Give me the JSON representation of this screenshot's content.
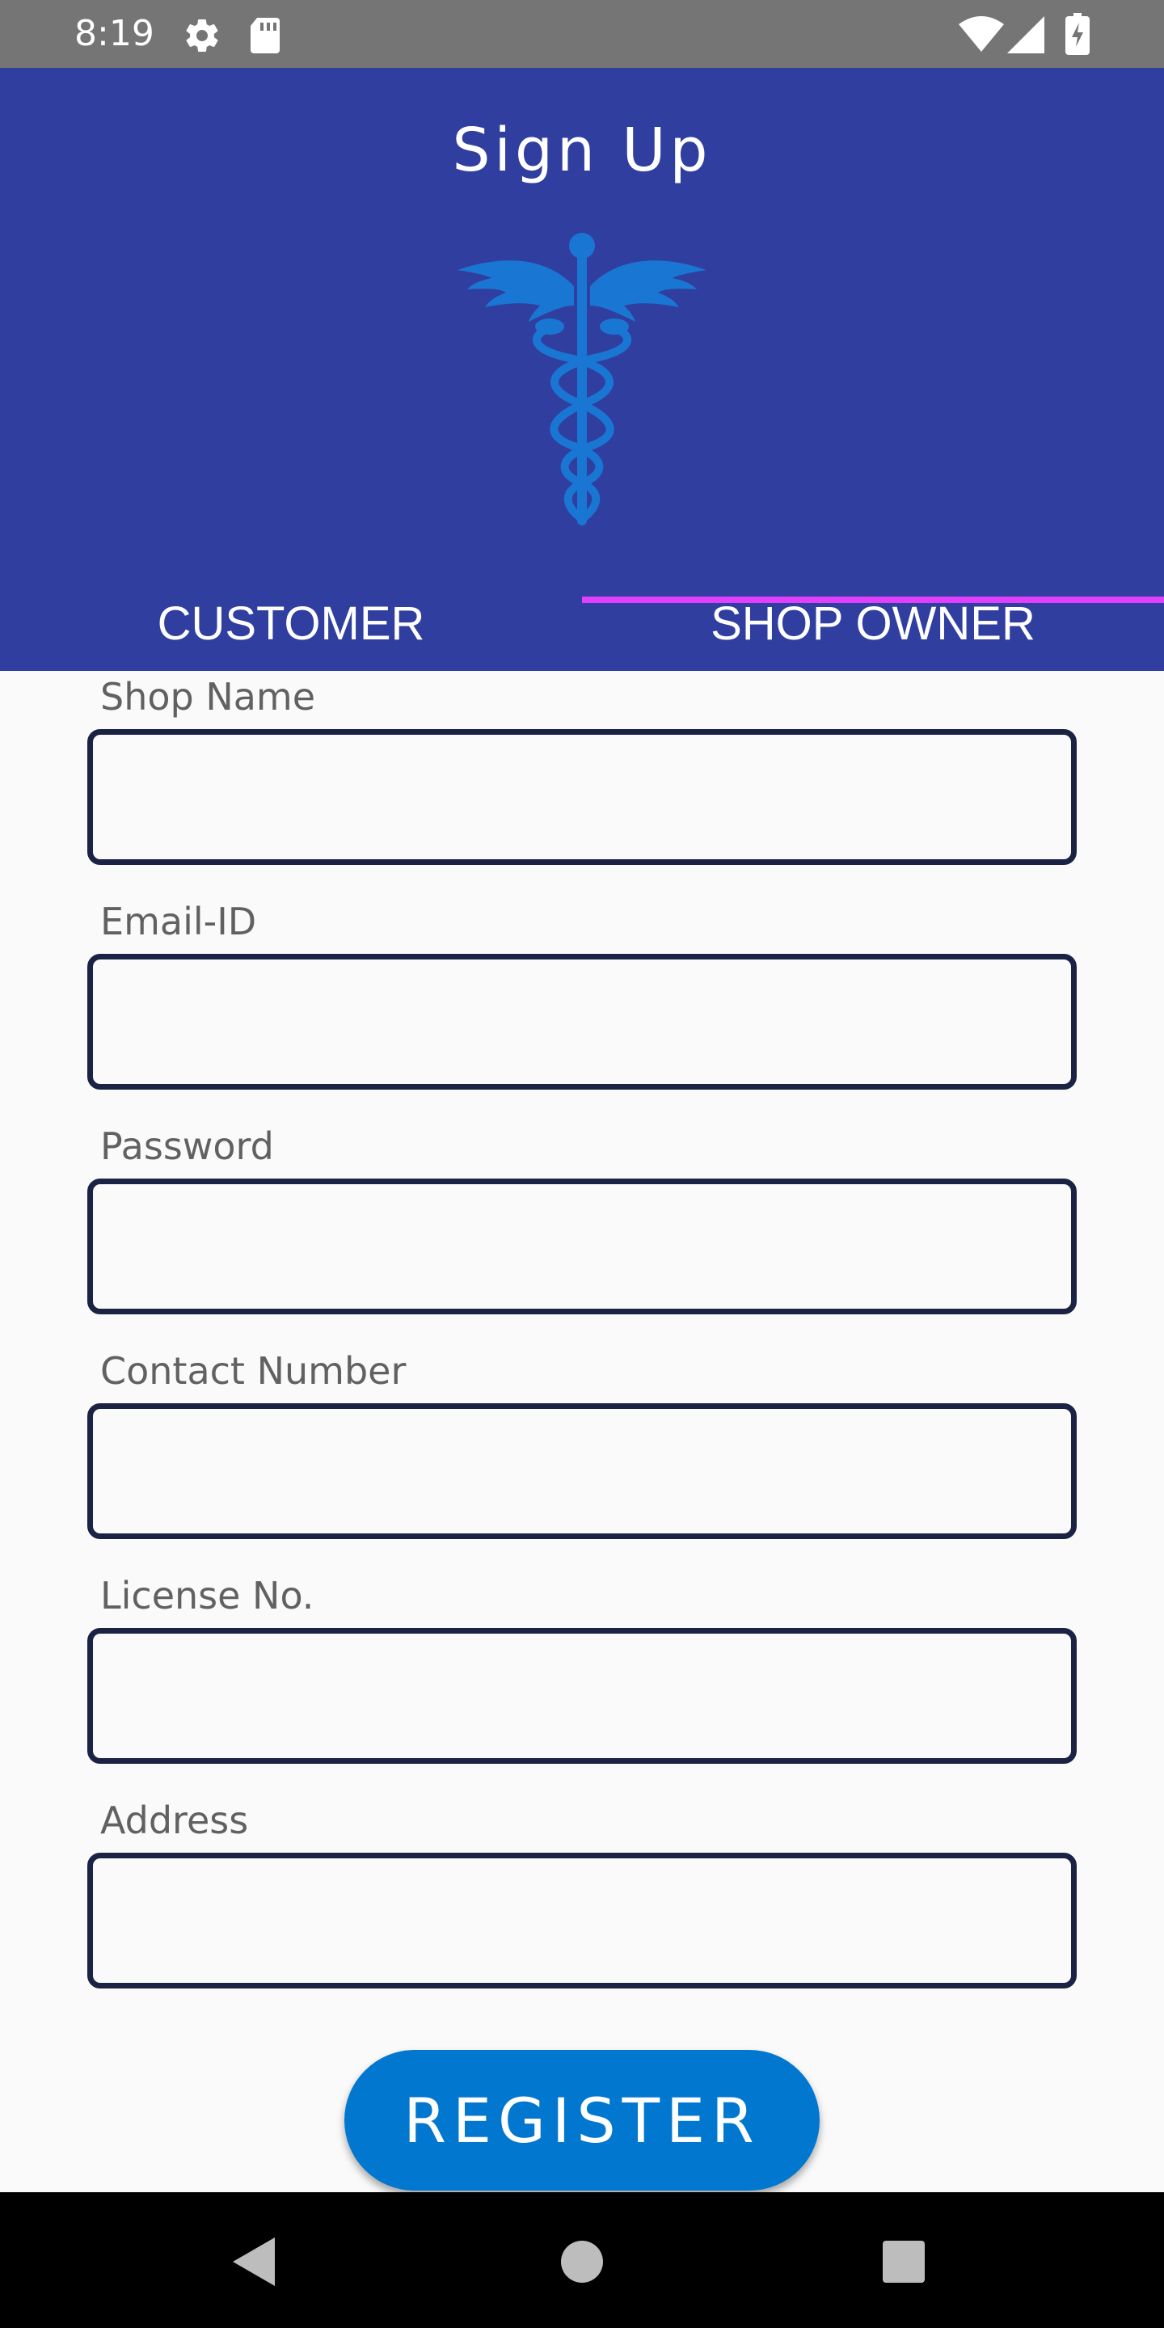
{
  "status_bar": {
    "time": "8:19",
    "icons": [
      "gear-icon",
      "sd-card-icon",
      "wifi-icon",
      "signal-icon",
      "battery-icon"
    ]
  },
  "header": {
    "title": "Sign Up",
    "logo_icon": "caduceus-icon",
    "background_color": "#303F9F"
  },
  "tabs": [
    {
      "label": "CUSTOMER",
      "selected": false
    },
    {
      "label": "SHOP OWNER",
      "selected": true
    }
  ],
  "tab_indicator_color": "#E040FB",
  "form": {
    "fields": [
      {
        "label": "Shop Name",
        "value": "",
        "placeholder": ""
      },
      {
        "label": "Email-ID",
        "value": "",
        "placeholder": ""
      },
      {
        "label": "Password",
        "value": "",
        "placeholder": ""
      },
      {
        "label": "Contact Number",
        "value": "",
        "placeholder": ""
      },
      {
        "label": "License No.",
        "value": "",
        "placeholder": ""
      },
      {
        "label": "Address",
        "value": "",
        "placeholder": ""
      }
    ],
    "submit_label": "REGISTER",
    "submit_color": "#0277D0"
  },
  "nav_bar": {
    "buttons": [
      "back-icon",
      "home-icon",
      "recents-icon"
    ]
  }
}
